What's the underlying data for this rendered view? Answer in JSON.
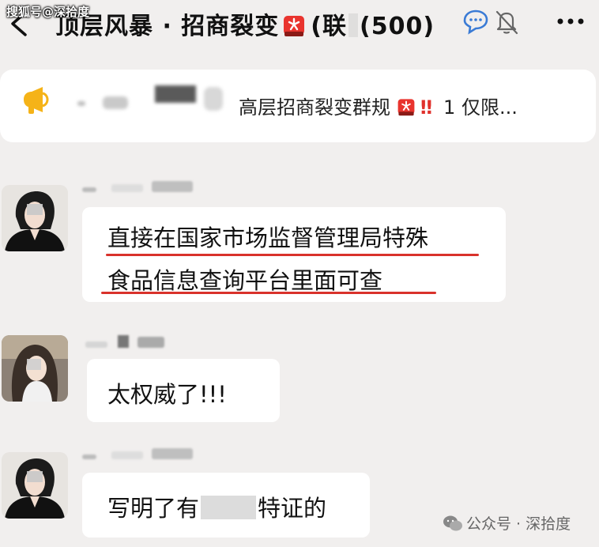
{
  "watermark_top": "搜狐号@深拾度",
  "header": {
    "title_prefix": "顶层风暴 · 招商裂变",
    "title_suffix": "(联创(500)",
    "title_suffix_display": "(联",
    "title_count": "(500)"
  },
  "pinned": {
    "text": "高层招商裂变群规",
    "tail": "1 仅限..."
  },
  "messages": [
    {
      "lines": [
        "直接在国家市场监督管理局特殊",
        "食品信息查询平台里面可查"
      ]
    },
    {
      "text": "太权威了!!!"
    },
    {
      "before": "写明了有",
      "after": "特证的"
    }
  ],
  "watermark_bottom": "公众号 · 深拾度",
  "colors": {
    "background": "#f1efee",
    "bubble": "#ffffff",
    "underline": "#d9322b",
    "alert_red": "#e0312c"
  }
}
